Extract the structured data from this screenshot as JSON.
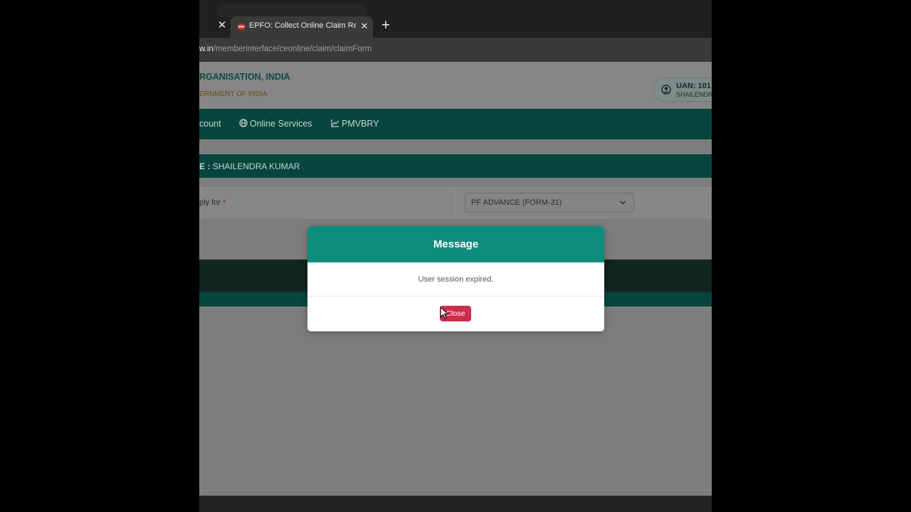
{
  "browser": {
    "active_tab_title": "EPFO: Collect Online Claim Receip",
    "url_host": "w.in",
    "url_path": "/memberinterface/ceonline/claim/claimForm"
  },
  "header": {
    "org_name": "RGANISATION, INDIA",
    "org_sub": "ERNMENT OF INDIA",
    "uan_label": "UAN: 101",
    "uan_name": "SHAILENDR"
  },
  "nav": {
    "items": [
      {
        "label": "count"
      },
      {
        "label": "Online Services"
      },
      {
        "label": "PMVBRY"
      }
    ]
  },
  "form": {
    "member_prefix": "E :",
    "member_name": "SHAILENDRA KUMAR",
    "apply_label": "ply for",
    "apply_required": "*",
    "claim_type": "PF ADVANCE (FORM-31)"
  },
  "modal": {
    "title": "Message",
    "message": "User session expired.",
    "close_label": "Close"
  },
  "colors": {
    "modal_header": "#0d8e7d",
    "close_button": "#d02c4c",
    "navbar_dimmed": "#06463f"
  }
}
